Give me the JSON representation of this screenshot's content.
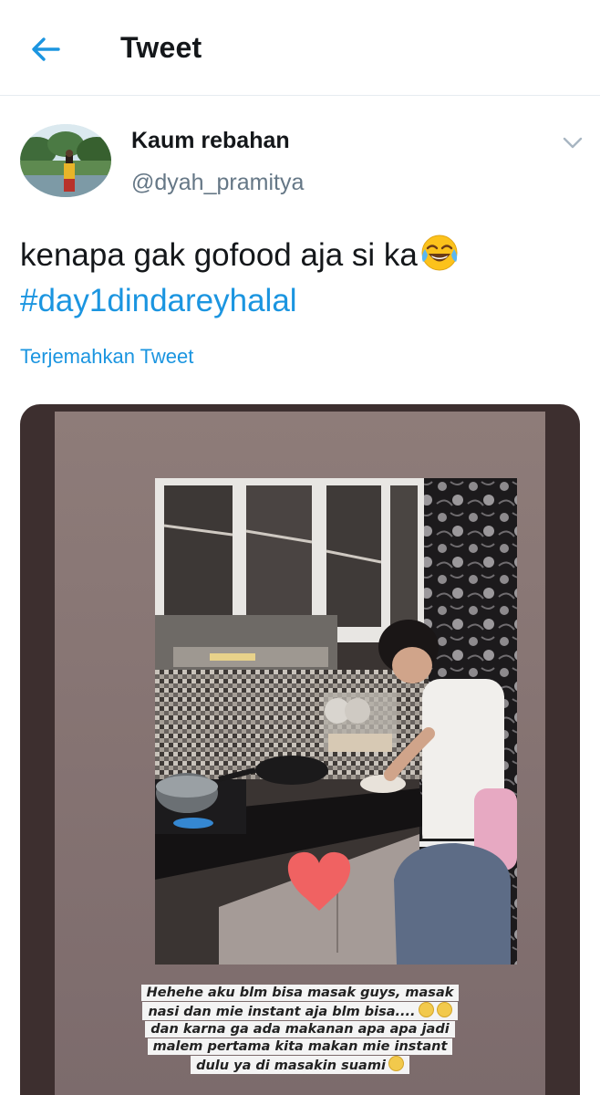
{
  "header": {
    "title": "Tweet"
  },
  "author": {
    "display_name": "Kaum rebahan",
    "handle": "@dyah_pramitya"
  },
  "tweet": {
    "text": "kenapa gak gofood aja si ka",
    "emoji": "face-with-tears-of-joy",
    "hashtag": "#day1dindareyhalal",
    "translate_label": "Terjemahkan Tweet"
  },
  "media": {
    "caption_lines": [
      "Hehehe aku blm bisa masak guys, masak",
      "nasi dan mie instant aja blm bisa....",
      "dan karna ga ada makanan apa apa jadi",
      "malem pertama kita makan mie instant",
      "dulu ya di masakin suami"
    ]
  },
  "colors": {
    "accent": "#1b95e0",
    "secondary_text": "#657786",
    "divider": "#e6ecf0"
  }
}
